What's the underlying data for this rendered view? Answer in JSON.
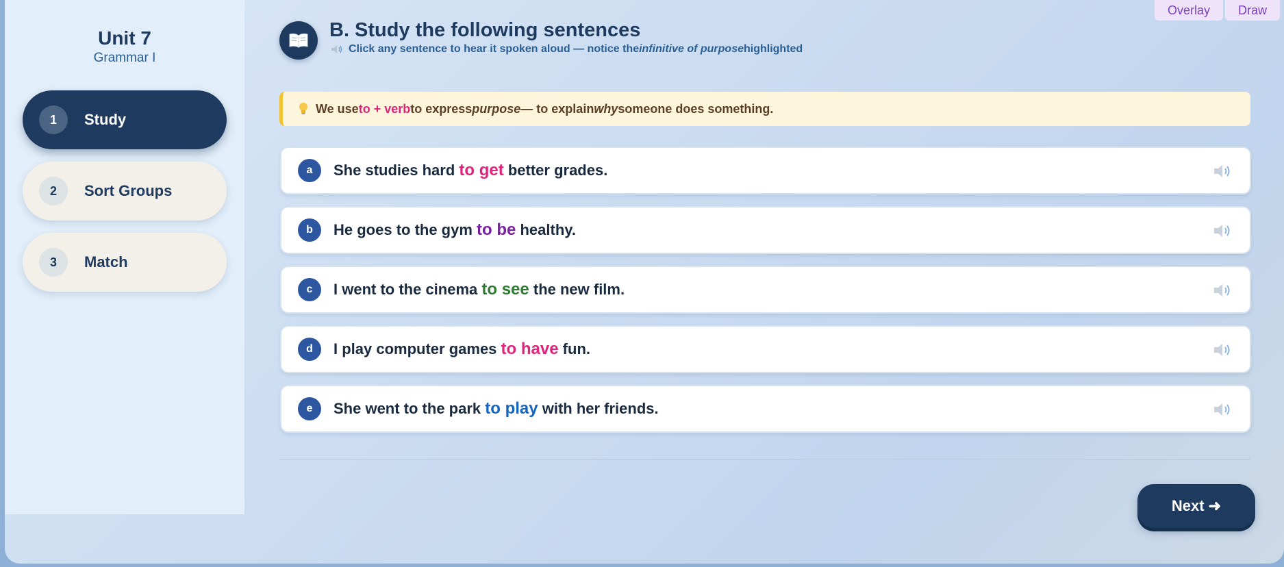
{
  "toolbar": {
    "overlay_label": "Overlay",
    "draw_label": "Draw"
  },
  "sidebar": {
    "unit_title": "Unit 7",
    "unit_subtitle": "Grammar I",
    "items": [
      {
        "num": "1",
        "label": "Study",
        "active": true
      },
      {
        "num": "2",
        "label": "Sort Groups",
        "active": false
      },
      {
        "num": "3",
        "label": "Match",
        "active": false
      }
    ]
  },
  "header": {
    "title": "B. Study the following sentences",
    "subtitle_pre": "Click any sentence to hear it spoken aloud — notice the ",
    "subtitle_em": "infinitive of purpose",
    "subtitle_post": " highlighted"
  },
  "tip": {
    "pre": "We use ",
    "highlight": "to + verb",
    "mid": " to express ",
    "em1": "purpose",
    "mid2": " — to explain ",
    "em2": "why",
    "post": " someone does something."
  },
  "sentences": [
    {
      "letter": "a",
      "before": "She studies hard ",
      "infinitive": "to get",
      "after": " better grades.",
      "color": "#e0247c"
    },
    {
      "letter": "b",
      "before": "He goes to the gym ",
      "infinitive": "to be",
      "after": " healthy.",
      "color": "#7a1fa2"
    },
    {
      "letter": "c",
      "before": "I went to the cinema ",
      "infinitive": "to see",
      "after": " the new film.",
      "color": "#2e7d32"
    },
    {
      "letter": "d",
      "before": "I play computer games ",
      "infinitive": "to have",
      "after": " fun.",
      "color": "#e0247c"
    },
    {
      "letter": "e",
      "before": "She went to the park ",
      "infinitive": "to play",
      "after": " with her friends.",
      "color": "#1565c0"
    }
  ],
  "footer": {
    "next_label": "Next ➜"
  }
}
